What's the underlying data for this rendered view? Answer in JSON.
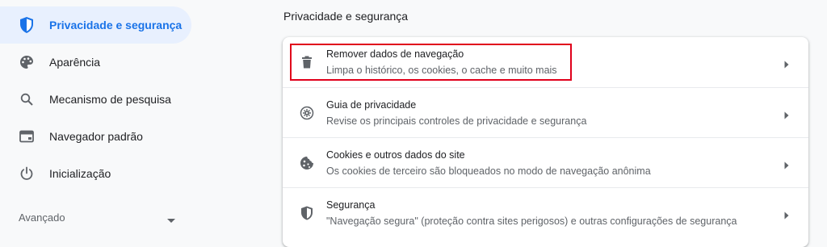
{
  "sidebar": {
    "items": [
      {
        "label": "Privacidade e segurança",
        "icon": "shield-icon",
        "active": true
      },
      {
        "label": "Aparência",
        "icon": "palette-icon"
      },
      {
        "label": "Mecanismo de pesquisa",
        "icon": "search-icon"
      },
      {
        "label": "Navegador padrão",
        "icon": "browser-window-icon"
      },
      {
        "label": "Inicialização",
        "icon": "power-icon"
      }
    ],
    "advanced_label": "Avançado"
  },
  "main": {
    "section_title": "Privacidade e segurança",
    "rows": [
      {
        "title": "Remover dados de navegação",
        "subtitle": "Limpa o histórico, os cookies, o cache e muito mais",
        "icon": "trash-icon"
      },
      {
        "title": "Guia de privacidade",
        "subtitle": "Revise os principais controles de privacidade e segurança",
        "icon": "privacy-guide-icon"
      },
      {
        "title": "Cookies e outros dados do site",
        "subtitle": "Os cookies de terceiro são bloqueados no modo de navegação anônima",
        "icon": "cookie-icon"
      },
      {
        "title": "Segurança",
        "subtitle": "\"Navegação segura\" (proteção contra sites perigosos) e outras configurações de segurança",
        "icon": "shield-icon"
      }
    ]
  },
  "colors": {
    "accent": "#1a73e8",
    "active_bg": "#e8f0fe",
    "highlight_border": "#e0001b",
    "page_bg": "#f8f9fa"
  }
}
